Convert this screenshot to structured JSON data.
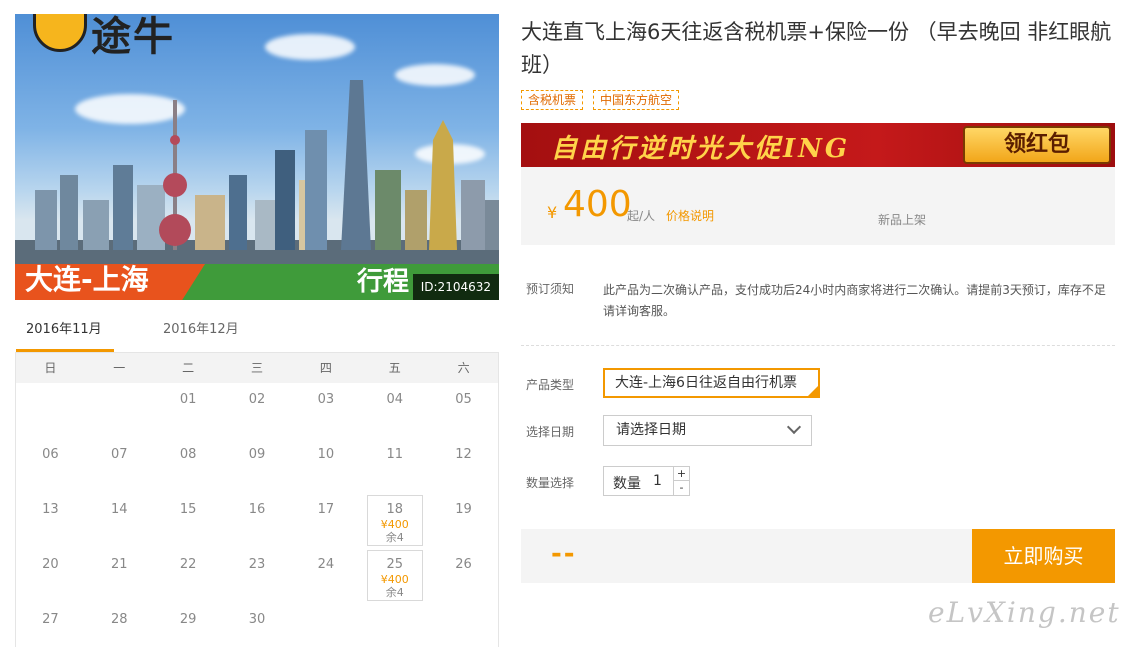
{
  "hero": {
    "logo_text": "途牛",
    "band_title": "大连-上海",
    "band_right": "行程",
    "id_tag": "ID:2104632"
  },
  "calendar": {
    "tabs": [
      {
        "label": "2016年11月",
        "active": true
      },
      {
        "label": "2016年12月",
        "active": false
      }
    ],
    "weekdays": [
      "日",
      "一",
      "二",
      "三",
      "四",
      "五",
      "六"
    ],
    "weeks": [
      [
        {
          "d": ""
        },
        {
          "d": ""
        },
        {
          "d": "01"
        },
        {
          "d": "02"
        },
        {
          "d": "03"
        },
        {
          "d": "04"
        },
        {
          "d": "05"
        }
      ],
      [
        {
          "d": "06"
        },
        {
          "d": "07"
        },
        {
          "d": "08"
        },
        {
          "d": "09"
        },
        {
          "d": "10"
        },
        {
          "d": "11"
        },
        {
          "d": "12"
        }
      ],
      [
        {
          "d": "13"
        },
        {
          "d": "14"
        },
        {
          "d": "15"
        },
        {
          "d": "16"
        },
        {
          "d": "17"
        },
        {
          "d": "18",
          "price": "¥400",
          "stock": "余4"
        },
        {
          "d": "19"
        }
      ],
      [
        {
          "d": "20"
        },
        {
          "d": "21"
        },
        {
          "d": "22"
        },
        {
          "d": "23"
        },
        {
          "d": "24"
        },
        {
          "d": "25",
          "price": "¥400",
          "stock": "余4"
        },
        {
          "d": "26"
        }
      ],
      [
        {
          "d": "27"
        },
        {
          "d": "28"
        },
        {
          "d": "29"
        },
        {
          "d": "30"
        },
        {
          "d": ""
        },
        {
          "d": ""
        },
        {
          "d": ""
        }
      ]
    ]
  },
  "product": {
    "title": "大连直飞上海6天往返含税机票+保险一份 （早去晚回 非红眼航班）",
    "tags": [
      "含税机票",
      "中国东方航空"
    ],
    "promo_text": "自由行逆时光大促ING",
    "promo_button": "领红包",
    "price_symbol": "¥",
    "price": "400",
    "price_unit": "起/人",
    "price_note": "价格说明",
    "new_tag": "新品上架"
  },
  "notice": {
    "label": "预订须知",
    "text": "此产品为二次确认产品，支付成功后24小时内商家将进行二次确认。请提前3天预订，库存不足请详询客服。"
  },
  "form": {
    "type_label": "产品类型",
    "type_value": "大连-上海6日往返自由行机票",
    "date_label": "选择日期",
    "date_placeholder": "请选择日期",
    "qty_label": "数量选择",
    "qty_prefix": "数量",
    "qty_value": "1",
    "plus": "+",
    "minus": "-"
  },
  "buy": {
    "total": "--",
    "button": "立即购买"
  },
  "watermark": "eLvXing.net",
  "colors": {
    "accent": "#f39800",
    "promo_red": "#c4191a"
  }
}
